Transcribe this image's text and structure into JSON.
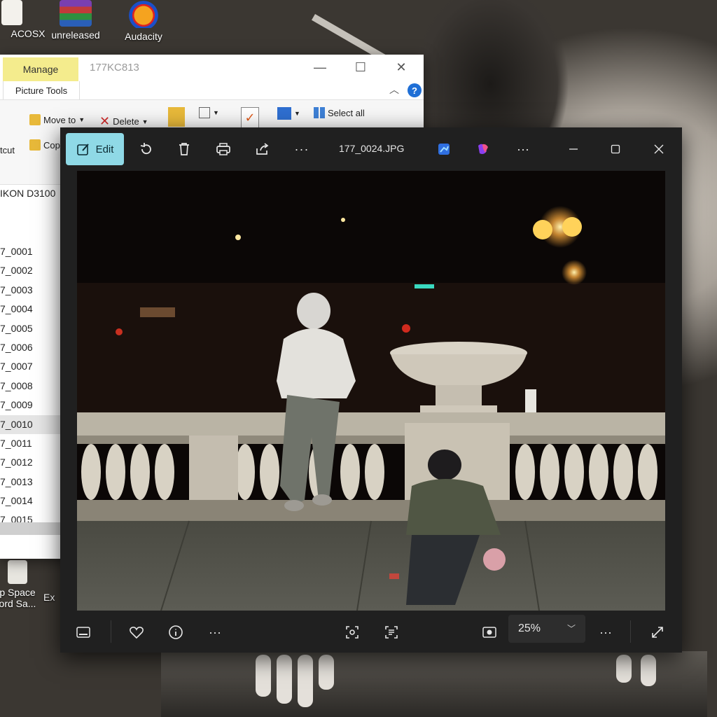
{
  "desktop": {
    "icons": [
      {
        "label": "ACOSX"
      },
      {
        "label": "unreleased"
      },
      {
        "label": "Audacity"
      },
      {
        "label": "p Space"
      },
      {
        "label": "ord Sa..."
      },
      {
        "label": "Ex"
      }
    ]
  },
  "explorer": {
    "manage_tab": "Manage",
    "picture_tools_tab": "Picture Tools",
    "title": "177KC813",
    "ribbon": {
      "move_to": "Move to",
      "delete": "Delete",
      "select_all": "Select all",
      "copy": "Cop",
      "cut": "tcut"
    },
    "path_text": "IKON D3100",
    "files": [
      "7_0001",
      "7_0002",
      "7_0003",
      "7_0004",
      "7_0005",
      "7_0006",
      "7_0007",
      "7_0008",
      "7_0009",
      "7_0010",
      "7_0011",
      "7_0012",
      "7_0013",
      "7_0014",
      "7_0015"
    ],
    "selected_file": "7_0010"
  },
  "photos": {
    "edit_label": "Edit",
    "filename": "177_0024.JPG",
    "zoom_value": "25%",
    "more_label": "···"
  },
  "colors": {
    "accent": "#8fd9e6",
    "manage_tab_bg": "#f4ec8d",
    "app_bg": "#202020"
  },
  "icon_names": [
    "edit-icon",
    "rotate-icon",
    "trash-icon",
    "print-icon",
    "share-icon",
    "more-icon",
    "designer-icon",
    "copilot-icon",
    "minimize-icon",
    "maximize-icon",
    "close-icon",
    "filmstrip-icon",
    "heart-icon",
    "info-icon",
    "crop-focus-icon",
    "text-scan-icon",
    "fit-screen-icon",
    "chevron-down-icon",
    "fullscreen-icon"
  ]
}
